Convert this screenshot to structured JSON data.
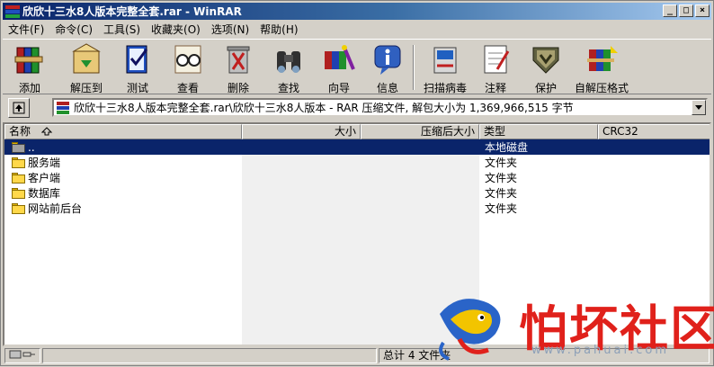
{
  "window": {
    "title": "欣欣十三水8人版本完整全套.rar - WinRAR",
    "buttons": {
      "minimize": "_",
      "maximize": "□",
      "close": "×"
    }
  },
  "menu": [
    "文件(F)",
    "命令(C)",
    "工具(S)",
    "收藏夹(O)",
    "选项(N)",
    "帮助(H)"
  ],
  "toolbar": [
    {
      "label": "添加",
      "icon": "add-books-icon"
    },
    {
      "label": "解压到",
      "icon": "extract-to-icon"
    },
    {
      "label": "测试",
      "icon": "test-icon"
    },
    {
      "label": "查看",
      "icon": "view-glasses-icon"
    },
    {
      "label": "删除",
      "icon": "delete-icon"
    },
    {
      "label": "查找",
      "icon": "find-binoculars-icon"
    },
    {
      "label": "向导",
      "icon": "wizard-icon"
    },
    {
      "label": "信息",
      "icon": "info-icon"
    },
    {
      "label": "扫描病毒",
      "icon": "scan-virus-icon"
    },
    {
      "label": "注释",
      "icon": "comment-icon"
    },
    {
      "label": "保护",
      "icon": "protect-shield-icon"
    },
    {
      "label": "自解压格式",
      "icon": "sfx-icon"
    }
  ],
  "address": {
    "path": "欣欣十三水8人版本完整全套.rar\\欣欣十三水8人版本 - RAR 压缩文件, 解包大小为 1,369,966,515 字节"
  },
  "columns": {
    "name": "名称",
    "size": "大小",
    "packed": "压缩后大小",
    "type": "类型",
    "crc": "CRC32"
  },
  "files": [
    {
      "name": "..",
      "type": "本地磁盘",
      "selected": true
    },
    {
      "name": "服务端",
      "type": "文件夹",
      "selected": false
    },
    {
      "name": "客户端",
      "type": "文件夹",
      "selected": false
    },
    {
      "name": "数据库",
      "type": "文件夹",
      "selected": false
    },
    {
      "name": "网站前后台",
      "type": "文件夹",
      "selected": false
    }
  ],
  "status": {
    "total": "总计 4 文件夹"
  },
  "watermark": {
    "text": "怕坏社区",
    "url": "www.pahuai.com"
  },
  "colors": {
    "title_active": "#0a246a",
    "selection": "#0a246a",
    "chrome": "#d4d0c8",
    "watermark_red": "#e0211b"
  }
}
